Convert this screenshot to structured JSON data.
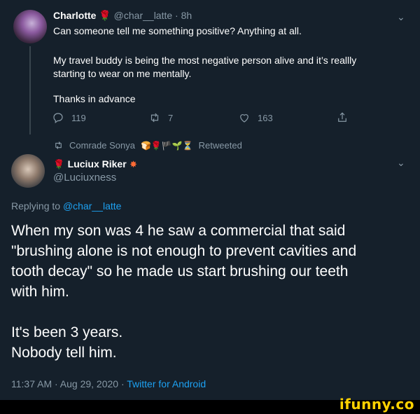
{
  "tweet1": {
    "author_name": "Charlotte",
    "author_handle": "@char__latte",
    "time": "· 8h",
    "line1": "Can someone tell me something positive? Anything at all.",
    "line2": "My travel buddy is being the most negative person alive and it’s reallly",
    "line3": "starting to wear on me mentally.",
    "line4": "Thanks in advance",
    "reply_count": "119",
    "retweet_count": "7",
    "like_count": "163"
  },
  "retweet_bar": {
    "user": "Comrade Sonya",
    "emoji": "🍞🌹🏴🌱⏳",
    "label": "Retweeted"
  },
  "tweet2": {
    "author_name": "Luciux Riker",
    "author_handle": "@Luciuxness",
    "replying_prefix": "Replying to",
    "replying_handle": "@char__latte",
    "p1": "When my son was 4 he saw a commercial that said",
    "p2": "\"brushing alone is not enough to prevent cavities and",
    "p3": "tooth decay\" so he made us start brushing our teeth",
    "p4": "with him.",
    "p5": "It's been 3 years.",
    "p6": "Nobody tell him.",
    "timestamp": "11:37 AM · Aug 29, 2020 ·",
    "source": "Twitter for Android"
  },
  "watermark": "ifunny.co",
  "colors": {
    "background": "#15202b",
    "muted": "#8899a6",
    "link": "#1da1f2",
    "watermark": "#ffd200"
  }
}
